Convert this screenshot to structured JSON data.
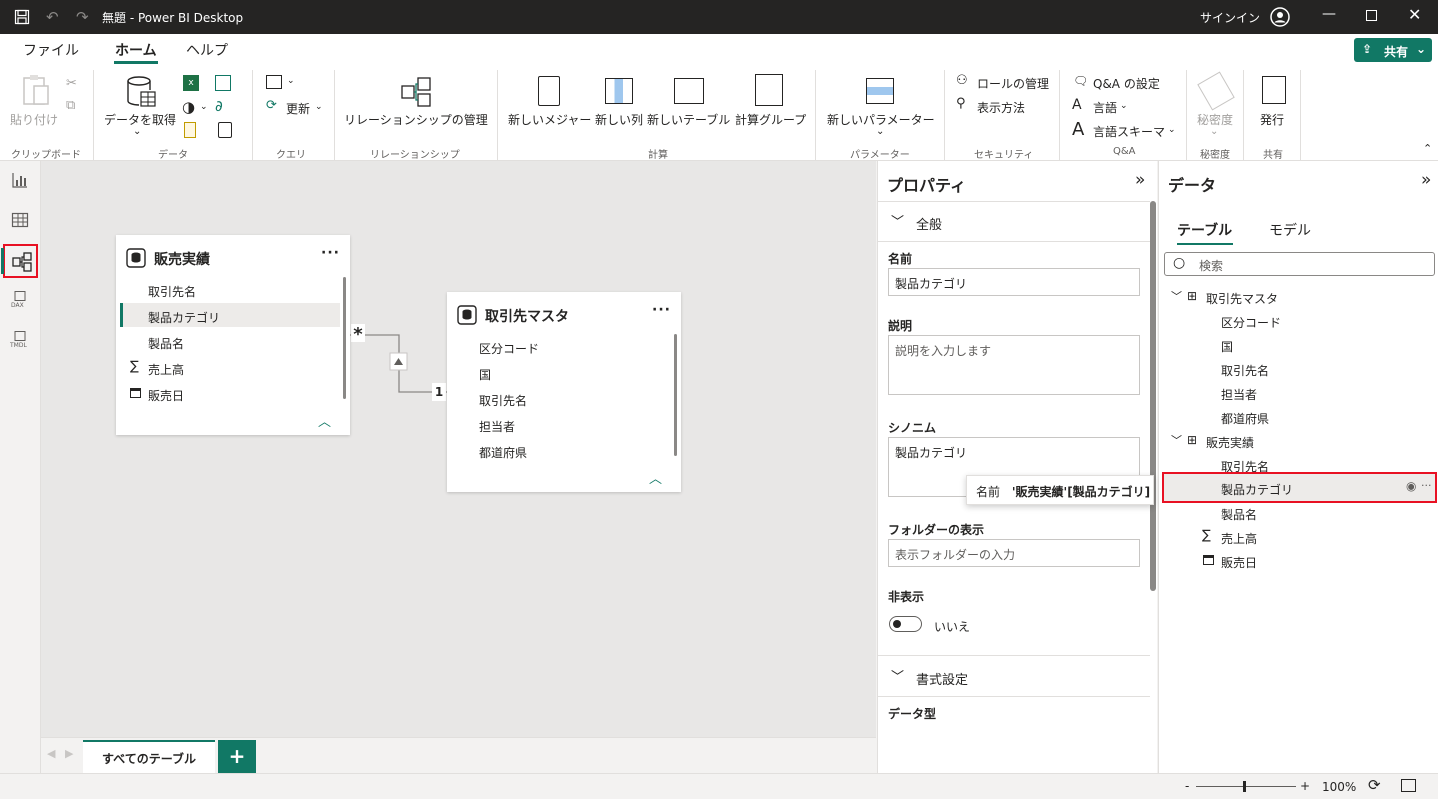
{
  "titlebar": {
    "title": "無題 - Power BI Desktop",
    "signin": "サインイン"
  },
  "menu": {
    "file": "ファイル",
    "home": "ホーム",
    "help": "ヘルプ",
    "share": "共有"
  },
  "ribbon": {
    "paste": "貼り付け",
    "get_data": "データを取得",
    "refresh": "更新",
    "manage_relationships": "リレーションシップの管理",
    "new_measure": "新しいメジャー",
    "new_column": "新しい列",
    "new_table": "新しいテーブル",
    "calc_group": "計算グループ",
    "new_parameter": "新しいパラメーター",
    "manage_roles": "ロールの管理",
    "view_as": "表示方法",
    "qa_setup": "Q&A の設定",
    "language": "言語",
    "language_schema": "言語スキーマ",
    "sensitivity": "秘密度",
    "publish": "発行",
    "groups": {
      "clipboard": "クリップボード",
      "data": "データ",
      "query": "クエリ",
      "relationships": "リレーションシップ",
      "calculations": "計算",
      "parameters": "パラメーター",
      "security": "セキュリティ",
      "qa": "Q&A",
      "sensitivity": "秘密度",
      "share": "共有"
    }
  },
  "rail": {
    "dax": "DAX",
    "tmdl": "TMDL"
  },
  "canvas": {
    "sales_table": {
      "title": "販売実績",
      "fields": [
        "取引先名",
        "製品カテゴリ",
        "製品名",
        "売上高",
        "販売日"
      ]
    },
    "customer_table": {
      "title": "取引先マスタ",
      "fields": [
        "区分コード",
        "国",
        "取引先名",
        "担当者",
        "都道府県"
      ]
    },
    "rel_many": "*",
    "rel_one": "1"
  },
  "tabs": {
    "all_tables": "すべてのテーブル",
    "add": "+"
  },
  "status": {
    "zoom": "100%",
    "minus": "-",
    "plus": "+"
  },
  "properties": {
    "title": "プロパティ",
    "general": "全般",
    "name_label": "名前",
    "name_value": "製品カテゴリ",
    "desc_label": "説明",
    "desc_placeholder": "説明を入力します",
    "synonyms_label": "シノニム",
    "synonyms_value": "製品カテゴリ",
    "folder_label": "フォルダーの表示",
    "folder_placeholder": "表示フォルダーの入力",
    "hidden_label": "非表示",
    "hidden_value": "いいえ",
    "formatting": "書式設定",
    "datatype_label": "データ型"
  },
  "data": {
    "title": "データ",
    "tab_tables": "テーブル",
    "tab_model": "モデル",
    "search_placeholder": "検索",
    "tables": [
      {
        "name": "取引先マスタ",
        "fields": [
          "区分コード",
          "国",
          "取引先名",
          "担当者",
          "都道府県"
        ]
      },
      {
        "name": "販売実績",
        "fields": [
          "取引先名",
          "製品カテゴリ",
          "製品名",
          "売上高",
          "販売日"
        ]
      }
    ]
  },
  "tooltip": {
    "label": "名前",
    "value": "'販売実績'[製品カテゴリ]"
  },
  "colors": {
    "accent": "#117865",
    "highlight": "#e81123",
    "titlebar": "#252423"
  }
}
